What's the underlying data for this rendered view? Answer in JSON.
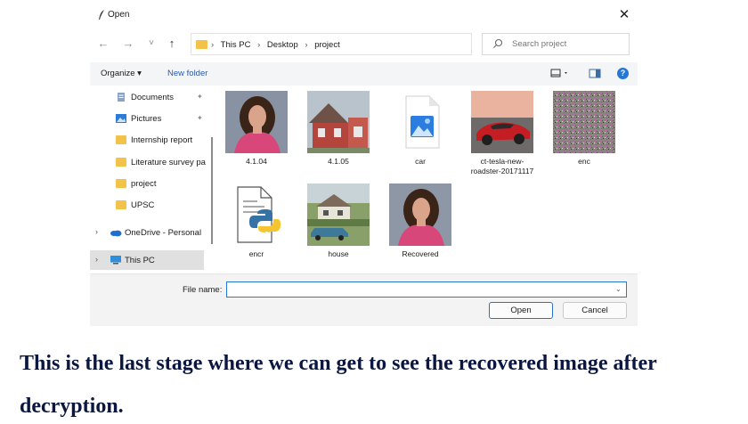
{
  "dialog": {
    "title": "Open",
    "close_glyph": "✕"
  },
  "nav": {
    "back_glyph": "←",
    "forward_glyph": "→",
    "recent_glyph": "˅",
    "up_glyph": "↑",
    "breadcrumbs": [
      "This PC",
      "Desktop",
      "project"
    ],
    "breadcrumb_sep": "›",
    "refresh_glyph": "↻",
    "search_placeholder": "Search project"
  },
  "toolbar": {
    "organize_label": "Organize ▾",
    "new_folder_label": "New folder",
    "help_glyph": "?"
  },
  "sidebar": {
    "items": [
      {
        "label": "Documents",
        "icon": "documents-icon"
      },
      {
        "label": "Pictures",
        "icon": "pictures-icon"
      },
      {
        "label": "Internship report",
        "icon": "folder-icon"
      },
      {
        "label": "Literature survey pa",
        "icon": "folder-icon"
      },
      {
        "label": "project",
        "icon": "folder-icon"
      },
      {
        "label": "UPSC",
        "icon": "folder-icon"
      },
      {
        "label": "OneDrive - Personal",
        "icon": "onedrive-icon"
      },
      {
        "label": "This PC",
        "icon": "pc-icon"
      }
    ],
    "pin_glyph": "📌",
    "chevron_glyph": "›"
  },
  "files": [
    {
      "name": "4.1.04",
      "thumb": "portrait"
    },
    {
      "name": "4.1.05",
      "thumb": "house-red"
    },
    {
      "name": "car",
      "thumb": "image-file"
    },
    {
      "name": "ct-tesla-new-roadster-20171117",
      "thumb": "car-red"
    },
    {
      "name": "enc",
      "thumb": "noise"
    },
    {
      "name": "encr",
      "thumb": "python-file"
    },
    {
      "name": "house",
      "thumb": "house-green"
    },
    {
      "name": "Recovered",
      "thumb": "portrait"
    }
  ],
  "footer": {
    "file_name_label": "File name:",
    "file_name_value": "",
    "open_label": "Open",
    "cancel_label": "Cancel"
  },
  "caption": "This is the last stage where we can get to see the recovered image after decryption."
}
